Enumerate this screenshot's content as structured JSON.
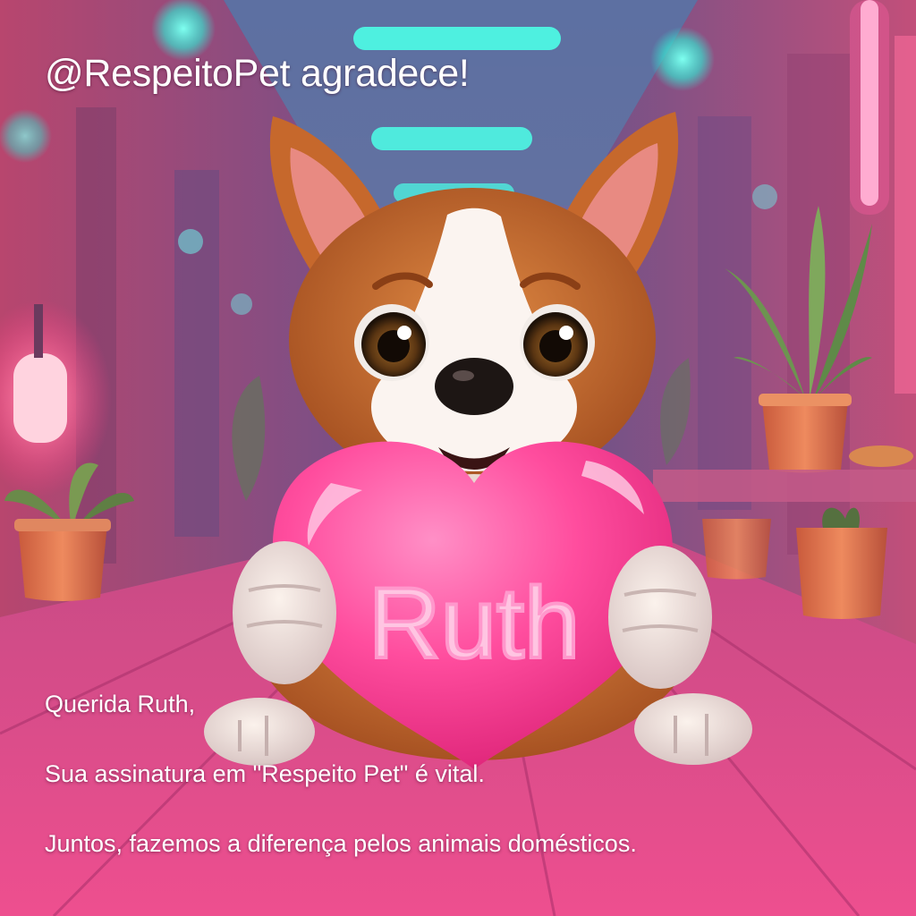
{
  "header": {
    "handle_title": "@RespeitoPet agradece!"
  },
  "message": {
    "greeting": "Querida Ruth,",
    "line1": "Sua assinatura em \"Respeito Pet\" é vital.",
    "line2": "Juntos, fazemos a diferença pelos animais domésticos."
  },
  "illustration": {
    "heart_text": "Ruth",
    "colors": {
      "hallway_pink": "#e0508a",
      "neon_cyan": "#3fe8d8",
      "heart_pink": "#ff4fa0",
      "fur_orange": "#c8682a"
    }
  }
}
